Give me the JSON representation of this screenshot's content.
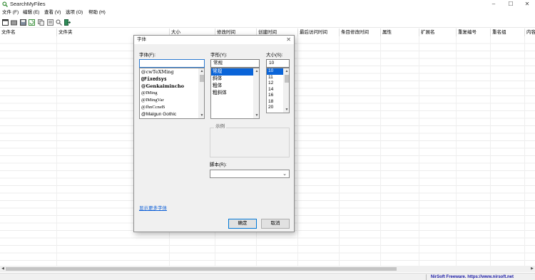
{
  "window": {
    "title": "SearchMyFiles"
  },
  "menu": [
    "文件 (F)",
    "编辑 (E)",
    "查看 (V)",
    "选项 (O)",
    "帮助 (H)"
  ],
  "columns": [
    "文件名",
    "文件夹",
    "大小",
    "修改时间",
    "创建时间",
    "最后访问时间",
    "条目修改时间",
    "属性",
    "扩展名",
    "重复编号",
    "重名组",
    "内容"
  ],
  "status": {
    "text": "NirSoft Freeware. https://www.nirsoft.net"
  },
  "font_dialog": {
    "title": "字体",
    "font_label": "字体(F):",
    "font_value": "",
    "fonts": [
      "@cwTeXMing",
      "@Fixedsys",
      "@Genkaimincho",
      "@IMing",
      "@IMingVar",
      "@JhnCcneB",
      "@Malgun Gothic"
    ],
    "style_label": "字形(Y):",
    "style_value": "常规",
    "styles": [
      "常规",
      "斜体",
      "粗体",
      "粗斜体"
    ],
    "size_label": "大小(S):",
    "size_value": "10",
    "sizes": [
      "10",
      "11",
      "12",
      "14",
      "16",
      "18",
      "20"
    ],
    "sample_label": "示例",
    "script_label": "脚本(R):",
    "script_value": "",
    "more_fonts_link": "显示更多字体",
    "ok_label": "确定",
    "cancel_label": "取消"
  },
  "colors": {
    "selection": "#0a64d8",
    "link": "#0b5ed7",
    "status_text": "#1a1aa6"
  }
}
